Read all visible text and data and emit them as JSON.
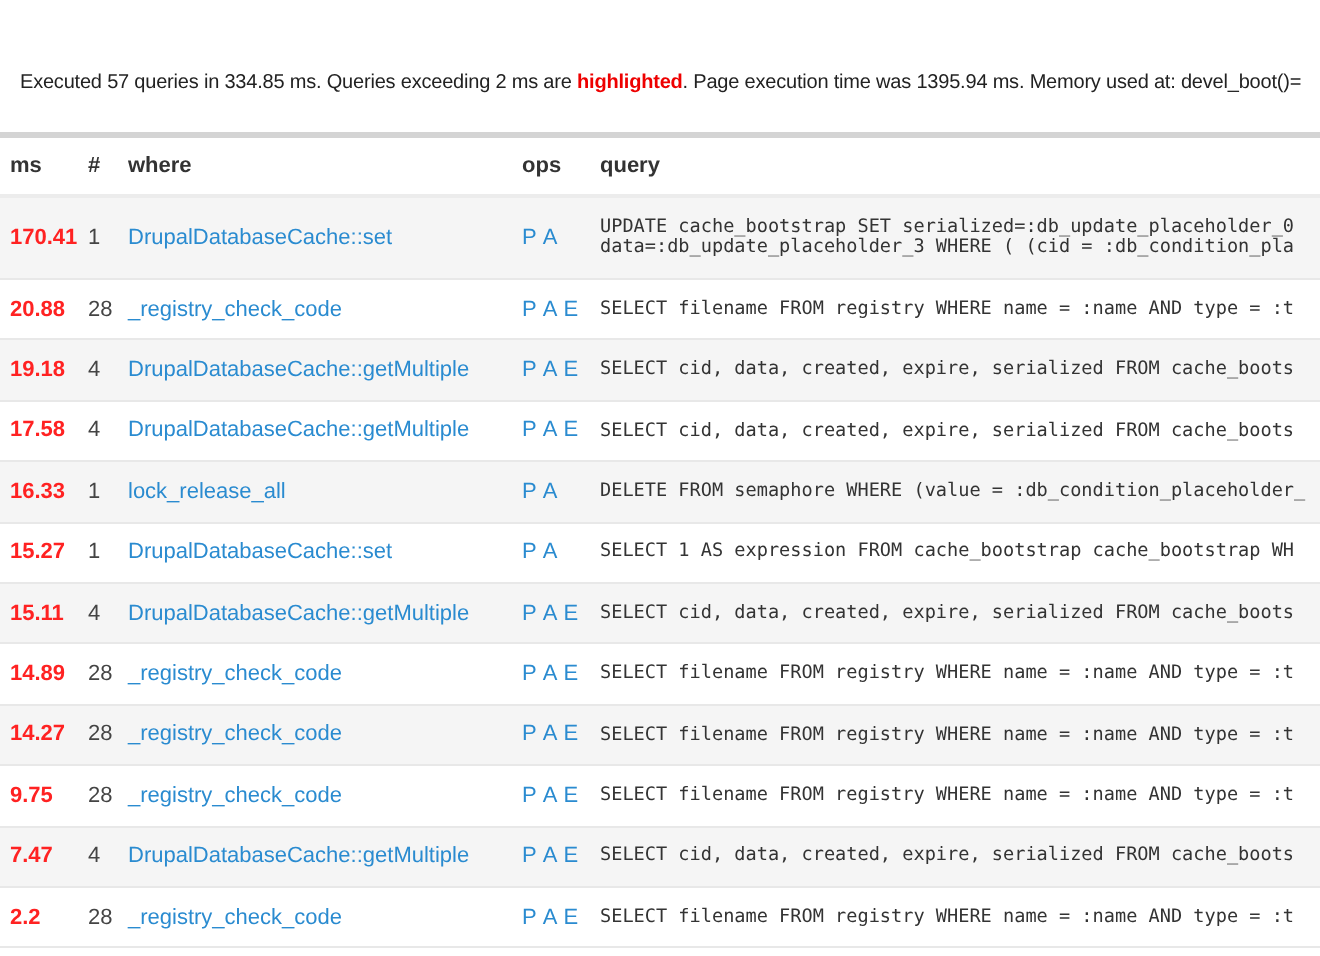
{
  "summary": "Executed 57 queries in 334.85 ms. Queries exceeding 2 ms are **highlighted**. Page execution time was 1395.94 ms. Memory used at: devel_boot()=",
  "table": {
    "columns": [
      "ms",
      "#",
      "where",
      "ops",
      "query"
    ],
    "rows": [
      {
        "ms": "170.41",
        "count": "1",
        "where": "DrupalDatabaseCache::set",
        "ops": [
          "P",
          "A"
        ],
        "query": "UPDATE cache_bootstrap SET serialized=:db_update_placeholder_0\ndata=:db_update_placeholder_3 WHERE ( (cid = :db_condition_pla"
      },
      {
        "ms": "20.88",
        "count": "28",
        "where": "_registry_check_code",
        "ops": [
          "P",
          "A",
          "E"
        ],
        "query": "SELECT filename FROM registry WHERE name = :name AND type = :t"
      },
      {
        "ms": "19.18",
        "count": "4",
        "where": "DrupalDatabaseCache::getMultiple",
        "ops": [
          "P",
          "A",
          "E"
        ],
        "query": "SELECT cid, data, created, expire, serialized FROM cache_boots"
      },
      {
        "ms": "17.58",
        "count": "4",
        "where": "DrupalDatabaseCache::getMultiple",
        "ops": [
          "P",
          "A",
          "E"
        ],
        "query": "SELECT cid, data, created, expire, serialized FROM cache_boots"
      },
      {
        "ms": "16.33",
        "count": "1",
        "where": "lock_release_all",
        "ops": [
          "P",
          "A"
        ],
        "query": "DELETE FROM semaphore WHERE (value = :db_condition_placeholder_"
      },
      {
        "ms": "15.27",
        "count": "1",
        "where": "DrupalDatabaseCache::set",
        "ops": [
          "P",
          "A"
        ],
        "query": "SELECT 1 AS expression FROM cache_bootstrap cache_bootstrap WH"
      },
      {
        "ms": "15.11",
        "count": "4",
        "where": "DrupalDatabaseCache::getMultiple",
        "ops": [
          "P",
          "A",
          "E"
        ],
        "query": "SELECT cid, data, created, expire, serialized FROM cache_boots"
      },
      {
        "ms": "14.89",
        "count": "28",
        "where": "_registry_check_code",
        "ops": [
          "P",
          "A",
          "E"
        ],
        "query": "SELECT filename FROM registry WHERE name = :name AND type = :t"
      },
      {
        "ms": "14.27",
        "count": "28",
        "where": "_registry_check_code",
        "ops": [
          "P",
          "A",
          "E"
        ],
        "query": "SELECT filename FROM registry WHERE name = :name AND type = :t"
      },
      {
        "ms": "9.75",
        "count": "28",
        "where": "_registry_check_code",
        "ops": [
          "P",
          "A",
          "E"
        ],
        "query": "SELECT filename FROM registry WHERE name = :name AND type = :t"
      },
      {
        "ms": "7.47",
        "count": "4",
        "where": "DrupalDatabaseCache::getMultiple",
        "ops": [
          "P",
          "A",
          "E"
        ],
        "query": "SELECT cid, data, created, expire, serialized FROM cache_boots"
      },
      {
        "ms": "2.2",
        "count": "28",
        "where": "_registry_check_code",
        "ops": [
          "P",
          "A",
          "E"
        ],
        "query": "SELECT filename FROM registry WHERE name = :name AND type = :t"
      }
    ]
  }
}
